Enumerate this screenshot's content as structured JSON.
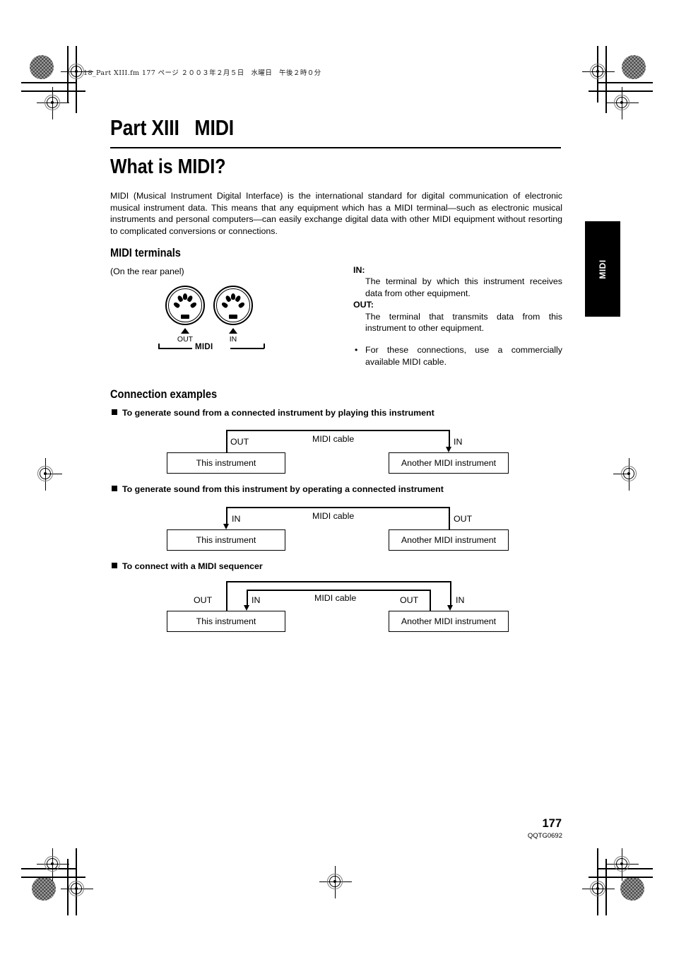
{
  "print_marks": {
    "file_info": "18_Part XIII.fm  177 ページ  ２００３年２月５日　水曜日　午後２時０分"
  },
  "header": {
    "part_title": "Part XIII   MIDI",
    "chapter_title": "What is MIDI?"
  },
  "intro": "MIDI (Musical Instrument Digital Interface) is the international standard for digital communication of electronic musical instrument data. This means that any equipment which has a MIDI terminal—such as electronic musical instruments and personal computers—can easily exchange digital data with other MIDI equipment without resorting to complicated conversions or connections.",
  "terminals": {
    "heading": "MIDI terminals",
    "rear_panel_note": "(On the rear panel)",
    "figure": {
      "left_connector_label": "OUT",
      "right_connector_label": "IN",
      "bracket_label": "MIDI"
    },
    "definitions": [
      {
        "term": "IN:",
        "description": "The terminal by which this instrument receives data from other equipment."
      },
      {
        "term": "OUT:",
        "description": "The terminal that transmits data from this instrument to other equipment."
      }
    ],
    "bullet": {
      "marker": "•",
      "text": "For these connections, use a commercially available MIDI cable."
    }
  },
  "connection_examples": {
    "heading": "Connection examples",
    "examples": [
      {
        "sub_heading": "To generate sound from a connected instrument by playing this instrument",
        "left_box": "This instrument",
        "right_box": "Another MIDI instrument",
        "left_port": "OUT",
        "right_port": "IN",
        "cable_label": "MIDI cable"
      },
      {
        "sub_heading": "To generate sound from this instrument by operating a connected instrument",
        "left_box": "This instrument",
        "right_box": "Another MIDI instrument",
        "left_port": "IN",
        "right_port": "OUT",
        "cable_label": "MIDI cable"
      },
      {
        "sub_heading": "To connect with a MIDI sequencer",
        "left_box": "This instrument",
        "right_box": "Another MIDI instrument",
        "left_port_out": "OUT",
        "left_port_in": "IN",
        "right_port_out": "OUT",
        "right_port_in": "IN",
        "cable_label": "MIDI cable"
      }
    ]
  },
  "side_tab": {
    "label": "MIDI"
  },
  "footer": {
    "page_number": "177",
    "doc_code": "QQTG0692"
  }
}
